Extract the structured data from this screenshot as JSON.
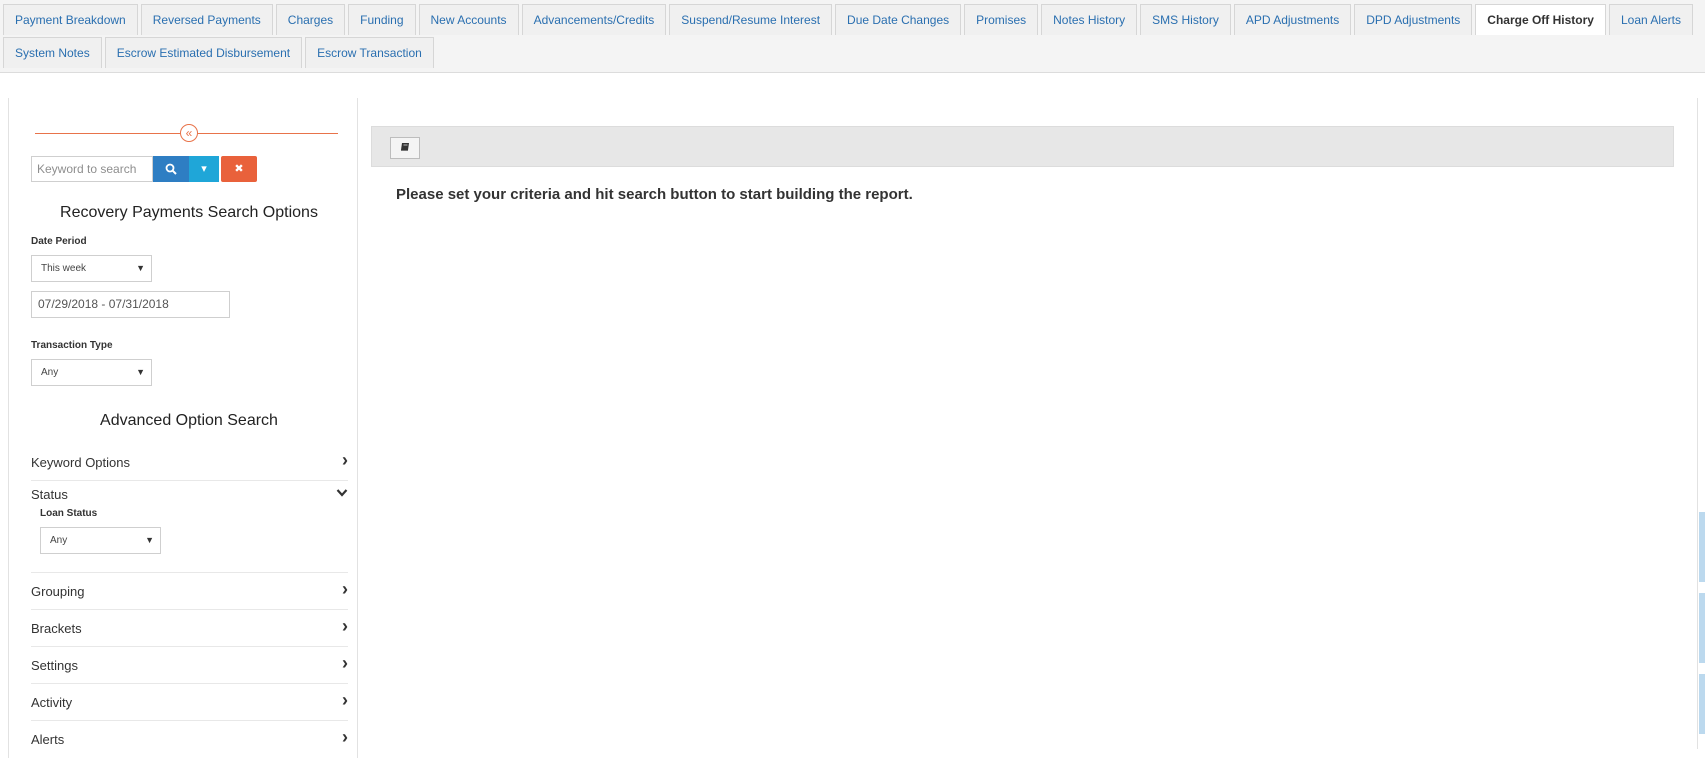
{
  "tabs": {
    "row1": [
      {
        "label": "Payment Breakdown"
      },
      {
        "label": "Reversed Payments"
      },
      {
        "label": "Charges"
      },
      {
        "label": "Funding"
      },
      {
        "label": "New Accounts"
      },
      {
        "label": "Advancements/Credits"
      },
      {
        "label": "Suspend/Resume Interest"
      },
      {
        "label": "Due Date Changes"
      },
      {
        "label": "Promises"
      },
      {
        "label": "Notes History"
      },
      {
        "label": "SMS History"
      },
      {
        "label": "APD Adjustments"
      },
      {
        "label": "DPD Adjustments"
      },
      {
        "label": "Charge Off History"
      },
      {
        "label": "Loan Alerts"
      }
    ],
    "row2": [
      {
        "label": "System Notes"
      },
      {
        "label": "Escrow Estimated Disbursement"
      },
      {
        "label": "Escrow Transaction"
      }
    ],
    "active": "Charge Off History"
  },
  "sidebar": {
    "search_placeholder": "Keyword to search",
    "search_title": "Recovery Payments Search Options",
    "date_period_label": "Date Period",
    "date_period_value": "This week",
    "date_range": "07/29/2018 - 07/31/2018",
    "transaction_type_label": "Transaction Type",
    "transaction_type_value": "Any",
    "advanced_title": "Advanced Option Search",
    "keyword_options": "Keyword Options",
    "status": "Status",
    "loan_status_label": "Loan Status",
    "loan_status_value": "Any",
    "grouping": "Grouping",
    "brackets": "Brackets",
    "settings": "Settings",
    "activity": "Activity",
    "alerts": "Alerts"
  },
  "main": {
    "message": "Please set your criteria and hit search button to start building the report."
  }
}
